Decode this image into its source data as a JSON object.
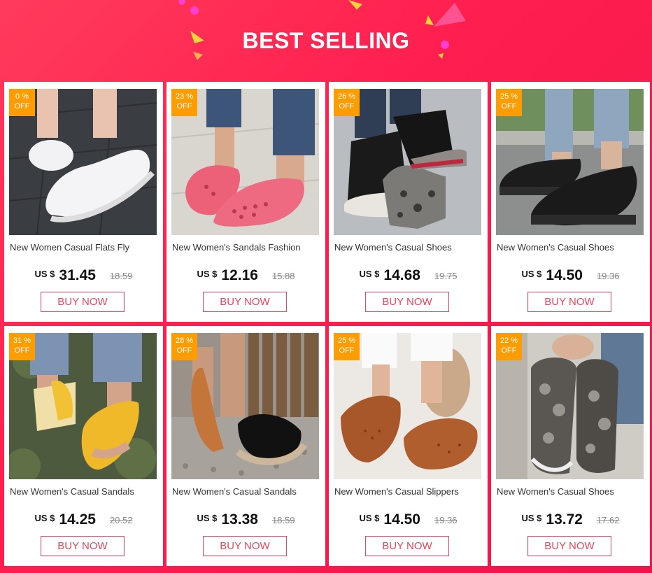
{
  "header": {
    "title": "BEST SELLING"
  },
  "colors": {
    "accent": "#e8455e",
    "badge": "#ff9d00",
    "background": "#ff2a55"
  },
  "products": [
    {
      "badge_pct": "0  %",
      "badge_off": "OFF",
      "name": "New Women Casual Flats Fly",
      "currency": "US $",
      "price": "31.45",
      "old_price": "18.59",
      "button": "BUY NOW",
      "image": "white-knit-sneaker"
    },
    {
      "badge_pct": "23  %",
      "badge_off": "OFF",
      "name": "New Women's Sandals Fashion",
      "currency": "US $",
      "price": "12.16",
      "old_price": "15.88",
      "button": "BUY NOW",
      "image": "pink-cutout-sandal"
    },
    {
      "badge_pct": "26  %",
      "badge_off": "OFF",
      "name": "New Women's Casual Shoes",
      "currency": "US $",
      "price": "14.68",
      "old_price": "19.75",
      "button": "BUY NOW",
      "image": "black-snake-sneaker"
    },
    {
      "badge_pct": "25  %",
      "badge_off": "OFF",
      "name": "New Women's Casual Shoes",
      "currency": "US $",
      "price": "14.50",
      "old_price": "19.36",
      "button": "BUY NOW",
      "image": "black-slip-on"
    },
    {
      "badge_pct": "31  %",
      "badge_off": "OFF",
      "name": "New Women's Casual Sandals",
      "currency": "US $",
      "price": "14.25",
      "old_price": "20.52",
      "button": "BUY NOW",
      "image": "yellow-sandal"
    },
    {
      "badge_pct": "28  %",
      "badge_off": "OFF",
      "name": "New Women's Casual Sandals",
      "currency": "US $",
      "price": "13.38",
      "old_price": "18.59",
      "button": "BUY NOW",
      "image": "black-espadrille-sandal"
    },
    {
      "badge_pct": "25  %",
      "badge_off": "OFF",
      "name": "New Women's Casual Slippers",
      "currency": "US $",
      "price": "14.50",
      "old_price": "19.36",
      "button": "BUY NOW",
      "image": "brown-slingback-sandal"
    },
    {
      "badge_pct": "22  %",
      "badge_off": "OFF",
      "name": "New Women's Casual Shoes",
      "currency": "US $",
      "price": "13.72",
      "old_price": "17.62",
      "button": "BUY NOW",
      "image": "snake-print-slip-on"
    }
  ]
}
